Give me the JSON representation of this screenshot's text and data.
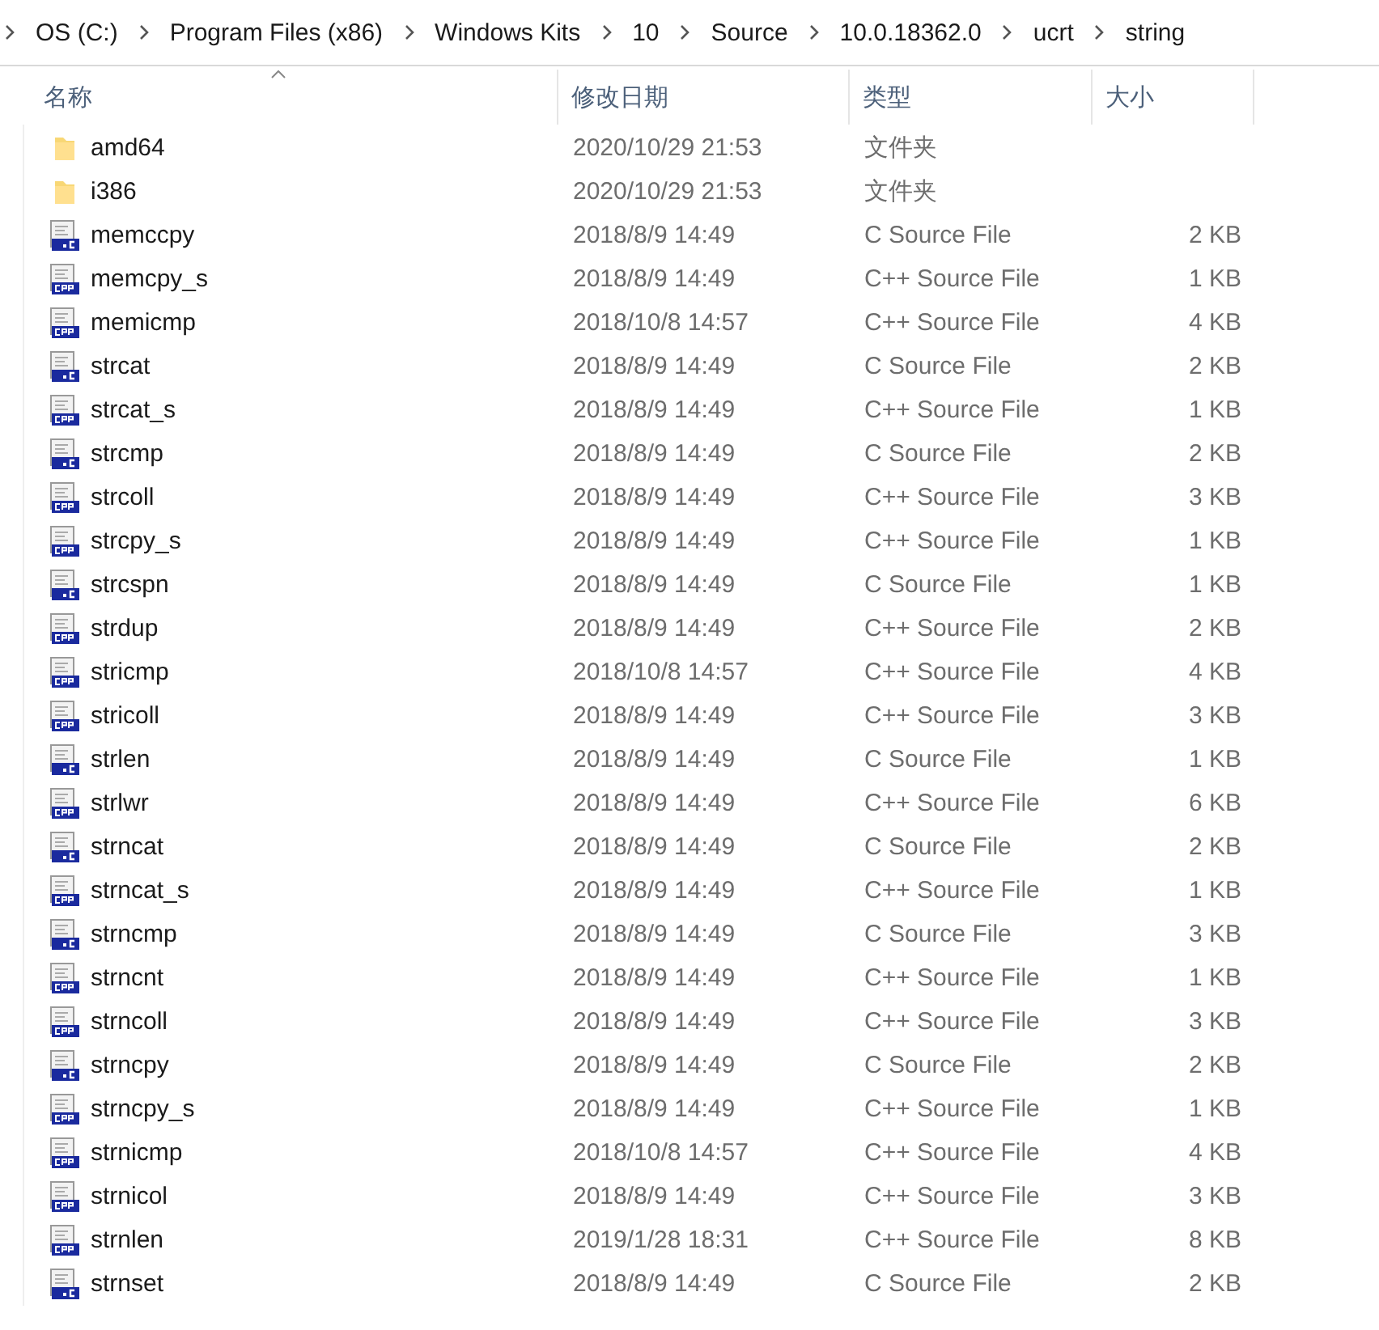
{
  "breadcrumb": [
    "OS (C:)",
    "Program Files (x86)",
    "Windows Kits",
    "10",
    "Source",
    "10.0.18362.0",
    "ucrt",
    "string"
  ],
  "columns": [
    {
      "label": "名称",
      "sorted": true
    },
    {
      "label": "修改日期",
      "sorted": false
    },
    {
      "label": "类型",
      "sorted": false
    },
    {
      "label": "大小",
      "sorted": false
    }
  ],
  "rows": [
    {
      "kind": "folder",
      "name": "amd64",
      "date": "2020/10/29 21:53",
      "type": "文件夹"
    },
    {
      "kind": "folder",
      "name": "i386",
      "date": "2020/10/29 21:53",
      "type": "文件夹"
    },
    {
      "kind": "c",
      "name": "memccpy",
      "date": "2018/8/9 14:49",
      "type": "C Source File",
      "size": "2 KB"
    },
    {
      "kind": "cpp",
      "name": "memcpy_s",
      "date": "2018/8/9 14:49",
      "type": "C++ Source File",
      "size": "1 KB"
    },
    {
      "kind": "cpp",
      "name": "memicmp",
      "date": "2018/10/8 14:57",
      "type": "C++ Source File",
      "size": "4 KB"
    },
    {
      "kind": "c",
      "name": "strcat",
      "date": "2018/8/9 14:49",
      "type": "C Source File",
      "size": "2 KB"
    },
    {
      "kind": "cpp",
      "name": "strcat_s",
      "date": "2018/8/9 14:49",
      "type": "C++ Source File",
      "size": "1 KB"
    },
    {
      "kind": "c",
      "name": "strcmp",
      "date": "2018/8/9 14:49",
      "type": "C Source File",
      "size": "2 KB"
    },
    {
      "kind": "cpp",
      "name": "strcoll",
      "date": "2018/8/9 14:49",
      "type": "C++ Source File",
      "size": "3 KB"
    },
    {
      "kind": "cpp",
      "name": "strcpy_s",
      "date": "2018/8/9 14:49",
      "type": "C++ Source File",
      "size": "1 KB"
    },
    {
      "kind": "c",
      "name": "strcspn",
      "date": "2018/8/9 14:49",
      "type": "C Source File",
      "size": "1 KB"
    },
    {
      "kind": "cpp",
      "name": "strdup",
      "date": "2018/8/9 14:49",
      "type": "C++ Source File",
      "size": "2 KB"
    },
    {
      "kind": "cpp",
      "name": "stricmp",
      "date": "2018/10/8 14:57",
      "type": "C++ Source File",
      "size": "4 KB"
    },
    {
      "kind": "cpp",
      "name": "stricoll",
      "date": "2018/8/9 14:49",
      "type": "C++ Source File",
      "size": "3 KB"
    },
    {
      "kind": "c",
      "name": "strlen",
      "date": "2018/8/9 14:49",
      "type": "C Source File",
      "size": "1 KB"
    },
    {
      "kind": "cpp",
      "name": "strlwr",
      "date": "2018/8/9 14:49",
      "type": "C++ Source File",
      "size": "6 KB"
    },
    {
      "kind": "c",
      "name": "strncat",
      "date": "2018/8/9 14:49",
      "type": "C Source File",
      "size": "2 KB"
    },
    {
      "kind": "cpp",
      "name": "strncat_s",
      "date": "2018/8/9 14:49",
      "type": "C++ Source File",
      "size": "1 KB"
    },
    {
      "kind": "c",
      "name": "strncmp",
      "date": "2018/8/9 14:49",
      "type": "C Source File",
      "size": "3 KB"
    },
    {
      "kind": "cpp",
      "name": "strncnt",
      "date": "2018/8/9 14:49",
      "type": "C++ Source File",
      "size": "1 KB"
    },
    {
      "kind": "cpp",
      "name": "strncoll",
      "date": "2018/8/9 14:49",
      "type": "C++ Source File",
      "size": "3 KB"
    },
    {
      "kind": "c",
      "name": "strncpy",
      "date": "2018/8/9 14:49",
      "type": "C Source File",
      "size": "2 KB"
    },
    {
      "kind": "cpp",
      "name": "strncpy_s",
      "date": "2018/8/9 14:49",
      "type": "C++ Source File",
      "size": "1 KB"
    },
    {
      "kind": "cpp",
      "name": "strnicmp",
      "date": "2018/10/8 14:57",
      "type": "C++ Source File",
      "size": "4 KB"
    },
    {
      "kind": "cpp",
      "name": "strnicol",
      "date": "2018/8/9 14:49",
      "type": "C++ Source File",
      "size": "3 KB"
    },
    {
      "kind": "cpp",
      "name": "strnlen",
      "date": "2019/1/28 18:31",
      "type": "C++ Source File",
      "size": "8 KB"
    },
    {
      "kind": "c",
      "name": "strnset",
      "date": "2018/8/9 14:49",
      "type": "C Source File",
      "size": "2 KB"
    }
  ]
}
